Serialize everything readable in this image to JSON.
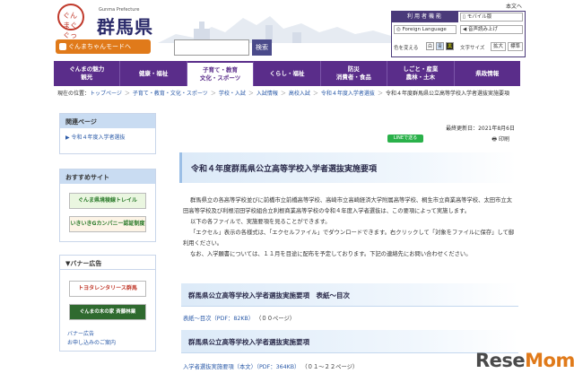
{
  "header": {
    "logo_circle_text": "ぐんまぐぐっと",
    "logo_subtitle": "Gunma Prefecture",
    "logo_title": "群馬県",
    "gunma_chan_label": "ぐんまちゃんモードへ",
    "search_placeholder": "",
    "search_button": "検索",
    "sitemap_label": "本文へ",
    "utility": {
      "heading": "利用者機能",
      "mobile_label": "モバイル版",
      "foreign_language_label": "Foreign Language",
      "read_aloud_label": "音声読み上げ",
      "color_change_label": "色を変える",
      "text_size_label": "文字サイズ",
      "enlarge_label": "拡大",
      "standard_label": "標準",
      "color_options": [
        "白",
        "青",
        "黒"
      ]
    }
  },
  "nav": {
    "items": [
      {
        "label": "ぐんまの魅力\n観光"
      },
      {
        "label": "健康・福祉"
      },
      {
        "label": "子育て・教育\n文化・スポーツ"
      },
      {
        "label": "くらし・福祉"
      },
      {
        "label": "防災\n消費者・食品"
      },
      {
        "label": "しごと・産業\n農林・土木"
      },
      {
        "label": "県政情報"
      }
    ],
    "active_index": 2
  },
  "breadcrumb": {
    "prefix": "現在の位置：",
    "items": [
      "トップページ",
      "子育て・教育・文化・スポーツ",
      "学校・入試",
      "入試情報",
      "高校入試",
      "令和４年度入学者選抜",
      "令和４年度群馬県公立高等学校入学者選抜実施要項"
    ]
  },
  "sidebar": {
    "related": {
      "heading": "関連ページ",
      "link": "令和４年度入学者選抜"
    },
    "recommended": {
      "heading": "おすすめサイト",
      "banner1": "ぐんま県境稜線トレイル",
      "banner2": "いきいきGカンパニー認証制度"
    },
    "ads": {
      "heading": "▼バナー広告",
      "banner1": "トヨタレンタリース群馬",
      "banner2": "ぐんまの木の家 斉藤林業",
      "link1": "バナー広告",
      "link2": "お申し込みのご案内"
    }
  },
  "main": {
    "updated": "最終更新日：2021年8月6日",
    "line_button": "LINEで送る",
    "print_button": "印刷",
    "title": "令和４年度群馬県公立高等学校入学者選抜実施要項",
    "paragraphs": [
      "群馬県立の各高等学校並びに前橋市立前橋高等学校、高崎市立高崎経済大学附属高等学校、桐生市立商業高等学校、太田市立太田高等学校及び利根沼田学校組合立利根商業高等学校の令和４年度入学者選抜は、この要項によって実施します。",
      "以下の各ファイルで、実施要項を見ることができます。",
      "「エクセル」表示の各様式は、「エクセルファイル」でダウンロードできます。右クリックして「対象をファイルに保存」して御利用ください。",
      "なお、入学願書については、１１月を目途に配布を予定しております。下記の連絡先にお問い合わせください。"
    ],
    "section1": {
      "title": "群馬県公立高等学校入学者選抜実施要項　表紙～目次",
      "link": "表紙～目次（PDF：82KB）",
      "pages": "（００ページ）"
    },
    "section2": {
      "title": "群馬県公立高等学校入学者選抜実施要項",
      "link": "入学者選抜実施要項（本文）（PDF：364KB）",
      "pages": "（０１～２２ページ）"
    }
  },
  "watermark": {
    "text_main": "Rese",
    "text_accent": "Mom"
  },
  "colors": {
    "nav_bg": "#5a2d8a",
    "accent_orange": "#e07a1a",
    "link_blue": "#2a5aa8",
    "banner_blue": "#dceaf8"
  }
}
